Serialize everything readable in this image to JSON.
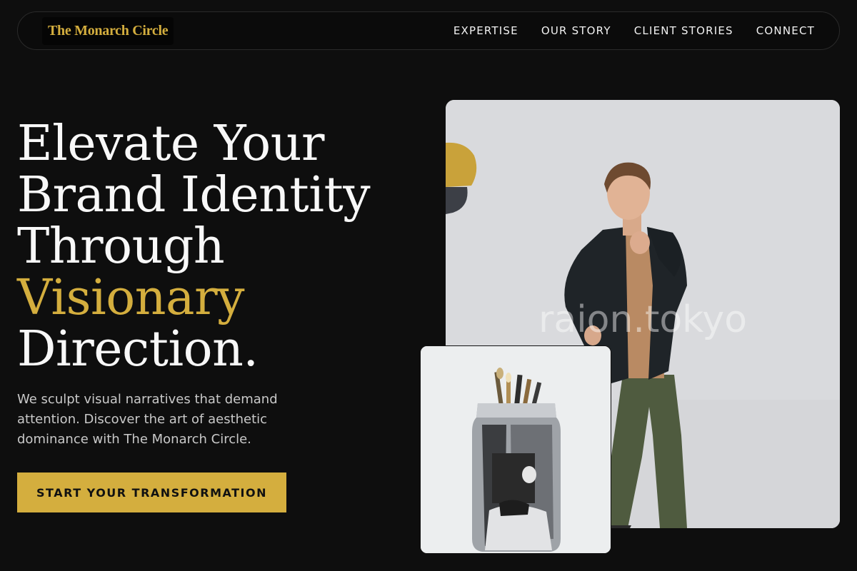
{
  "brand": {
    "name": "The Monarch Circle",
    "accent": "#d4ae3e"
  },
  "nav": {
    "items": [
      {
        "label": "EXPERTISE"
      },
      {
        "label": "OUR STORY"
      },
      {
        "label": "CLIENT STORIES"
      },
      {
        "label": "CONNECT"
      }
    ]
  },
  "hero": {
    "title_line1": "Elevate Your",
    "title_line2": "Brand Identity",
    "title_line3": "Through",
    "title_highlight": "Visionary",
    "title_line5": "Direction.",
    "subtitle": "We sculpt visual narratives that demand attention. Discover the art of aesthetic dominance with The Monarch Circle.",
    "cta_label": "START YOUR TRANSFORMATION"
  },
  "images": {
    "main_watermark": "raion.tokyo"
  }
}
